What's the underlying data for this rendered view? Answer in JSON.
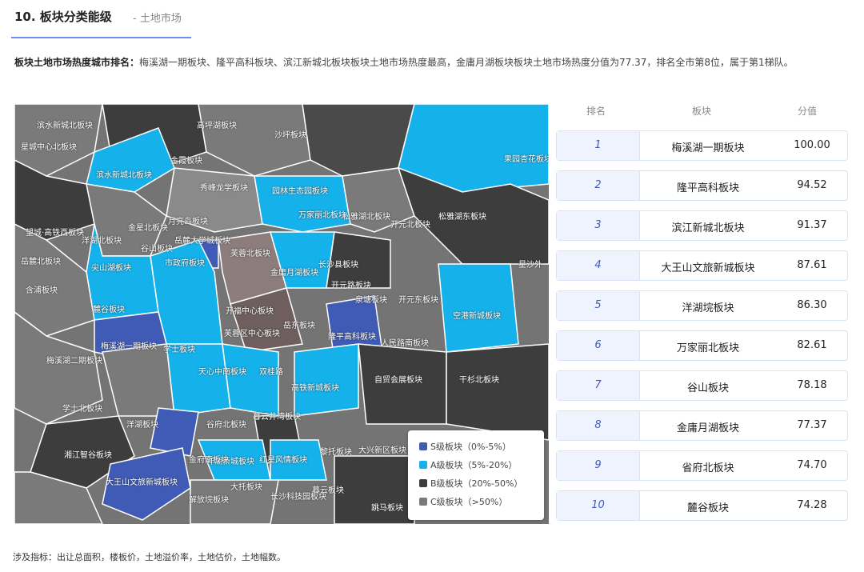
{
  "header": {
    "title": "10. 板块分类能级",
    "subtitle": "- 土地市场"
  },
  "summary": {
    "label": "板块土地市场热度城市排名：",
    "text": "梅溪湖一期板块、隆平高科板块、滨江新城北板块板块土地市场热度最高，金庸月湖板块板块土地市场热度分值为77.37，排名全市第8位，属于第1梯队。"
  },
  "map": {
    "labels": [
      "滨水新城北板块",
      "高坪湖板块",
      "星城中心北板块",
      "沙坪板块",
      "果园杏花板块",
      "滨水新城北板块",
      "金霞板块",
      "秀峰龙学板块",
      "园林生态园板块",
      "望城·高铁西板块",
      "金星北板块",
      "月亮岛板块",
      "万家丽北板块",
      "松雅湖北板块",
      "开元北板块",
      "松雅湖东板块",
      "洋湖北板块",
      "谷山板块",
      "岳麓北板块",
      "芙蓉北板块",
      "岳麓大学城板块",
      "尖山湖板块",
      "市政府板块",
      "长沙县板块",
      "金庸月湖板块",
      "开元路板块",
      "星沙外",
      "含浦板块",
      "麓谷板块",
      "梅溪湖一期板块",
      "开福中心板块",
      "泉塘板块",
      "开元东板块",
      "空港新城板块",
      "芙蓉区中心板块",
      "岳东板块",
      "隆平高科板块",
      "人民路南板块",
      "梅溪湖二期板块",
      "学士板块",
      "天心中南板块",
      "双桂路",
      "高铁新城板块",
      "自贸会展板块",
      "干杉北板块",
      "学士北板块",
      "洋湖板块",
      "谷府北板块",
      "暮云井湾板块",
      "湘江智谷板块",
      "洋湖新城板块",
      "金府南板块",
      "红星风情板块",
      "黎托板块",
      "大兴新区板块",
      "大王山文旅新城板块",
      "解放垸板块",
      "大托板块",
      "长沙科技园板块",
      "暮云板块",
      "跳马板块"
    ],
    "legend": [
      {
        "label": "S级板块（0%-5%）",
        "color": "#3f5bb5"
      },
      {
        "label": "A级板块（5%-20%）",
        "color": "#15b1ea"
      },
      {
        "label": "B级板块（20%-50%）",
        "color": "#3d3d3d"
      },
      {
        "label": "C级板块（>50%）",
        "color": "#7a7a7a"
      }
    ],
    "colors": {
      "S": "#3f5bb5",
      "A": "#15b1ea",
      "B": "#3d3d3d",
      "C": "#7a7a7a"
    }
  },
  "table": {
    "headers": {
      "rank": "排名",
      "block": "板块",
      "score": "分值"
    },
    "rows": [
      {
        "rank": "1",
        "block": "梅溪湖一期板块",
        "score": "100.00"
      },
      {
        "rank": "2",
        "block": "隆平高科板块",
        "score": "94.52"
      },
      {
        "rank": "3",
        "block": "滨江新城北板块",
        "score": "91.37"
      },
      {
        "rank": "4",
        "block": "大王山文旅新城板块",
        "score": "87.61"
      },
      {
        "rank": "5",
        "block": "洋湖垸板块",
        "score": "86.30"
      },
      {
        "rank": "6",
        "block": "万家丽北板块",
        "score": "82.61"
      },
      {
        "rank": "7",
        "block": "谷山板块",
        "score": "78.18"
      },
      {
        "rank": "8",
        "block": "金庸月湖板块",
        "score": "77.37"
      },
      {
        "rank": "9",
        "block": "省府北板块",
        "score": "74.70"
      },
      {
        "rank": "10",
        "block": "麓谷板块",
        "score": "74.28"
      }
    ]
  },
  "footer": {
    "text": "涉及指标：出让总面积，楼板价，土地溢价率，土地估价，土地幅数。"
  }
}
